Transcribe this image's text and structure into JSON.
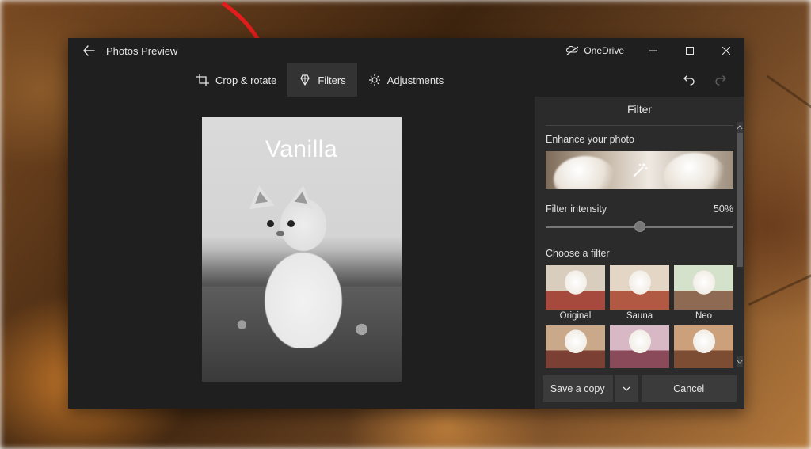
{
  "titlebar": {
    "app_title": "Photos Preview",
    "onedrive_label": "OneDrive"
  },
  "toolbar": {
    "crop_label": "Crop & rotate",
    "filters_label": "Filters",
    "adjustments_label": "Adjustments",
    "active_tab": "filters"
  },
  "photo": {
    "filter_overlay_label": "Vanilla"
  },
  "panel": {
    "title": "Filter",
    "enhance_label": "Enhance your photo",
    "intensity_label": "Filter intensity",
    "intensity_value_text": "50%",
    "intensity_value": 50,
    "choose_label": "Choose a filter",
    "filters_row1": [
      {
        "name": "Original",
        "wall": "#d9cdbd",
        "bed": "#a64a3d"
      },
      {
        "name": "Sauna",
        "wall": "#e4d6c4",
        "bed": "#b25944"
      },
      {
        "name": "Neo",
        "wall": "#d5e2cb",
        "bed": "#8f6a53"
      }
    ],
    "filters_row2": [
      {
        "name": "",
        "wall": "#caa88a",
        "bed": "#7c3f33"
      },
      {
        "name": "",
        "wall": "#d9b8c6",
        "bed": "#8b4a5a"
      },
      {
        "name": "",
        "wall": "#cba07b",
        "bed": "#7d4d33"
      }
    ]
  },
  "actions": {
    "save_label": "Save a copy",
    "cancel_label": "Cancel"
  },
  "colors": {
    "arrow": "#e51c1c",
    "panel_bg": "#2b2b2b",
    "chrome_bg": "#1f1f1f"
  }
}
